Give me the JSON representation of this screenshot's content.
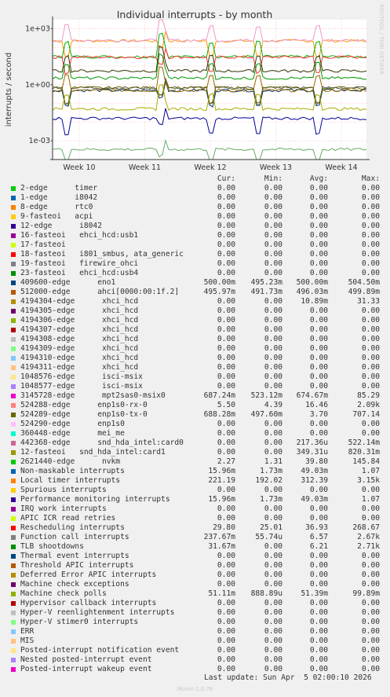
{
  "chart_data": {
    "type": "line",
    "title": "Individual interrupts - by month",
    "ylabel": "interrupts / second",
    "yscale": "log",
    "ylim": [
      0.0001,
      3000
    ],
    "yticks": [
      "1e+03",
      "1e+00",
      "1e-03"
    ],
    "xticks": [
      "Week 10",
      "Week 11",
      "Week 12",
      "Week 13",
      "Week 14"
    ],
    "watermark": "RRDTOOL / TOBI OETIKER",
    "grid": true,
    "series": [
      {
        "name": "Local timer interrupts",
        "color": "#ff9900",
        "level": 221.19
      },
      {
        "name": "TLB shootdowns",
        "color": "#00aa00",
        "level": 31.67
      },
      {
        "name": "Rescheduling interrupts",
        "color": "#ff3333",
        "level": 29.8
      },
      {
        "name": "Function call interrupts",
        "color": "#ee99cc",
        "level": 237.67
      },
      {
        "name": "409600-edge eno1",
        "color": "#003366",
        "level": 0.5
      },
      {
        "name": "512000-edge ahci[0000:00:1f.2]",
        "color": "#996600",
        "level": 0.49597
      },
      {
        "name": "3145728-edge mpt2sas0-msix0",
        "color": "#555555",
        "level": 0.68724
      },
      {
        "name": "524288-edge enp1s0-rx-0",
        "color": "#333300",
        "level": 5.5
      },
      {
        "name": "524289-edge enp1s0-tx-0",
        "color": "#666600",
        "level": 0.68828
      },
      {
        "name": "2621440-edge nvkm",
        "color": "#009900",
        "level": 2.27
      },
      {
        "name": "Non-maskable interrupts",
        "color": "#000099",
        "level": 0.01596
      },
      {
        "name": "Machine check polls",
        "color": "#aaaa00",
        "level": 0.05111
      },
      {
        "name": "12-fasteoi snd_hda_intel:card1",
        "color": "#66aa66",
        "level": 0.00035
      }
    ]
  },
  "legend": {
    "headers": [
      "Cur:",
      "Min:",
      "Avg:",
      "Max:"
    ],
    "rows": [
      {
        "label": "2-edge      timer",
        "color": "#00cc00",
        "cur": "0.00",
        "min": "0.00",
        "avg": "0.00",
        "max": "0.00"
      },
      {
        "label": "1-edge      i8042",
        "color": "#0066b3",
        "cur": "0.00",
        "min": "0.00",
        "avg": "0.00",
        "max": "0.00"
      },
      {
        "label": "8-edge      rtc0",
        "color": "#ff8000",
        "cur": "0.00",
        "min": "0.00",
        "avg": "0.00",
        "max": "0.00"
      },
      {
        "label": "9-fasteoi   acpi",
        "color": "#ffcc00",
        "cur": "0.00",
        "min": "0.00",
        "avg": "0.00",
        "max": "0.00"
      },
      {
        "label": "12-edge      i8042",
        "color": "#330099",
        "cur": "0.00",
        "min": "0.00",
        "avg": "0.00",
        "max": "0.00"
      },
      {
        "label": "16-fasteoi   ehci_hcd:usb1",
        "color": "#990099",
        "cur": "0.00",
        "min": "0.00",
        "avg": "0.00",
        "max": "0.00"
      },
      {
        "label": "17-fasteoi",
        "color": "#ccff00",
        "cur": "0.00",
        "min": "0.00",
        "avg": "0.00",
        "max": "0.00"
      },
      {
        "label": "18-fasteoi   i801_smbus, ata_generic",
        "color": "#ff0000",
        "cur": "0.00",
        "min": "0.00",
        "avg": "0.00",
        "max": "0.00"
      },
      {
        "label": "19-fasteoi   firewire_ohci",
        "color": "#808080",
        "cur": "0.00",
        "min": "0.00",
        "avg": "0.00",
        "max": "0.00"
      },
      {
        "label": "23-fasteoi   ehci_hcd:usb4",
        "color": "#008f00",
        "cur": "0.00",
        "min": "0.00",
        "avg": "0.00",
        "max": "0.00"
      },
      {
        "label": "409600-edge      eno1",
        "color": "#00487d",
        "cur": "500.00m",
        "min": "495.23m",
        "avg": "500.00m",
        "max": "504.50m"
      },
      {
        "label": "512000-edge      ahci[0000:00:1f.2]",
        "color": "#b35a00",
        "cur": "495.97m",
        "min": "491.73m",
        "avg": "496.03m",
        "max": "499.89m"
      },
      {
        "label": "4194304-edge      xhci_hcd",
        "color": "#b38f00",
        "cur": "0.00",
        "min": "0.00",
        "avg": "10.89m",
        "max": "31.33"
      },
      {
        "label": "4194305-edge      xhci_hcd",
        "color": "#6b006b",
        "cur": "0.00",
        "min": "0.00",
        "avg": "0.00",
        "max": "0.00"
      },
      {
        "label": "4194306-edge      xhci_hcd",
        "color": "#8fb300",
        "cur": "0.00",
        "min": "0.00",
        "avg": "0.00",
        "max": "0.00"
      },
      {
        "label": "4194307-edge      xhci_hcd",
        "color": "#b30000",
        "cur": "0.00",
        "min": "0.00",
        "avg": "0.00",
        "max": "0.00"
      },
      {
        "label": "4194308-edge      xhci_hcd",
        "color": "#bebebe",
        "cur": "0.00",
        "min": "0.00",
        "avg": "0.00",
        "max": "0.00"
      },
      {
        "label": "4194309-edge      xhci_hcd",
        "color": "#80ff80",
        "cur": "0.00",
        "min": "0.00",
        "avg": "0.00",
        "max": "0.00"
      },
      {
        "label": "4194310-edge      xhci_hcd",
        "color": "#80c9ff",
        "cur": "0.00",
        "min": "0.00",
        "avg": "0.00",
        "max": "0.00"
      },
      {
        "label": "4194311-edge      xhci_hcd",
        "color": "#ffc080",
        "cur": "0.00",
        "min": "0.00",
        "avg": "0.00",
        "max": "0.00"
      },
      {
        "label": "1048576-edge      isci-msix",
        "color": "#ffe680",
        "cur": "0.00",
        "min": "0.00",
        "avg": "0.00",
        "max": "0.00"
      },
      {
        "label": "1048577-edge      isci-msix",
        "color": "#aa80ff",
        "cur": "0.00",
        "min": "0.00",
        "avg": "0.00",
        "max": "0.00"
      },
      {
        "label": "3145728-edge      mpt2sas0-msix0",
        "color": "#ee00cc",
        "cur": "687.24m",
        "min": "523.12m",
        "avg": "674.67m",
        "max": "85.29"
      },
      {
        "label": "524288-edge      enp1s0-rx-0",
        "color": "#ff8080",
        "cur": "5.50",
        "min": "4.39",
        "avg": "16.46",
        "max": "2.09k"
      },
      {
        "label": "524289-edge      enp1s0-tx-0",
        "color": "#666600",
        "cur": "688.28m",
        "min": "497.60m",
        "avg": "3.70",
        "max": "707.14"
      },
      {
        "label": "524290-edge      enp1s0",
        "color": "#ffbfff",
        "cur": "0.00",
        "min": "0.00",
        "avg": "0.00",
        "max": "0.00"
      },
      {
        "label": "360448-edge      mei_me",
        "color": "#00ffcc",
        "cur": "0.00",
        "min": "0.00",
        "avg": "0.00",
        "max": "0.00"
      },
      {
        "label": "442368-edge      snd_hda_intel:card0",
        "color": "#cc6699",
        "cur": "0.00",
        "min": "0.00",
        "avg": "217.36u",
        "max": "522.14m"
      },
      {
        "label": "12-fasteoi   snd_hda_intel:card1",
        "color": "#999900",
        "cur": "0.00",
        "min": "0.00",
        "avg": "349.31u",
        "max": "820.31m"
      },
      {
        "label": "2621440-edge      nvkm",
        "color": "#00cc00",
        "cur": "2.27",
        "min": "1.31",
        "avg": "39.80",
        "max": "145.84"
      },
      {
        "label": "Non-maskable interrupts",
        "color": "#0066b3",
        "cur": "15.96m",
        "min": "1.73m",
        "avg": "49.03m",
        "max": "1.07"
      },
      {
        "label": "Local timer interrupts",
        "color": "#ff8000",
        "cur": "221.19",
        "min": "192.02",
        "avg": "312.39",
        "max": "3.15k"
      },
      {
        "label": "Spurious interrupts",
        "color": "#ffcc00",
        "cur": "0.00",
        "min": "0.00",
        "avg": "0.00",
        "max": "0.00"
      },
      {
        "label": "Performance monitoring interrupts",
        "color": "#330099",
        "cur": "15.96m",
        "min": "1.73m",
        "avg": "49.03m",
        "max": "1.07"
      },
      {
        "label": "IRQ work interrupts",
        "color": "#990099",
        "cur": "0.00",
        "min": "0.00",
        "avg": "0.00",
        "max": "0.00"
      },
      {
        "label": "APIC ICR read retries",
        "color": "#ccff00",
        "cur": "0.00",
        "min": "0.00",
        "avg": "0.00",
        "max": "0.00"
      },
      {
        "label": "Rescheduling interrupts",
        "color": "#ff0000",
        "cur": "29.80",
        "min": "25.01",
        "avg": "36.93",
        "max": "268.67"
      },
      {
        "label": "Function call interrupts",
        "color": "#808080",
        "cur": "237.67m",
        "min": "55.74u",
        "avg": "6.57",
        "max": "2.67k"
      },
      {
        "label": "TLB shootdowns",
        "color": "#008f00",
        "cur": "31.67m",
        "min": "0.00",
        "avg": "6.21",
        "max": "2.71k"
      },
      {
        "label": "Thermal event interrupts",
        "color": "#00487d",
        "cur": "0.00",
        "min": "0.00",
        "avg": "0.00",
        "max": "0.00"
      },
      {
        "label": "Threshold APIC interrupts",
        "color": "#b35a00",
        "cur": "0.00",
        "min": "0.00",
        "avg": "0.00",
        "max": "0.00"
      },
      {
        "label": "Deferred Error APIC interrupts",
        "color": "#b38f00",
        "cur": "0.00",
        "min": "0.00",
        "avg": "0.00",
        "max": "0.00"
      },
      {
        "label": "Machine check exceptions",
        "color": "#6b006b",
        "cur": "0.00",
        "min": "0.00",
        "avg": "0.00",
        "max": "0.00"
      },
      {
        "label": "Machine check polls",
        "color": "#8fb300",
        "cur": "51.11m",
        "min": "888.89u",
        "avg": "51.39m",
        "max": "99.89m"
      },
      {
        "label": "Hypervisor callback interrupts",
        "color": "#b30000",
        "cur": "0.00",
        "min": "0.00",
        "avg": "0.00",
        "max": "0.00"
      },
      {
        "label": "Hyper-V reenlightenment interrupts",
        "color": "#bebebe",
        "cur": "0.00",
        "min": "0.00",
        "avg": "0.00",
        "max": "0.00"
      },
      {
        "label": "Hyper-V stimer0 interrupts",
        "color": "#80ff80",
        "cur": "0.00",
        "min": "0.00",
        "avg": "0.00",
        "max": "0.00"
      },
      {
        "label": "ERR",
        "color": "#80c9ff",
        "cur": "0.00",
        "min": "0.00",
        "avg": "0.00",
        "max": "0.00"
      },
      {
        "label": "MIS",
        "color": "#ffc080",
        "cur": "0.00",
        "min": "0.00",
        "avg": "0.00",
        "max": "0.00"
      },
      {
        "label": "Posted-interrupt notification event",
        "color": "#ffe680",
        "cur": "0.00",
        "min": "0.00",
        "avg": "0.00",
        "max": "0.00"
      },
      {
        "label": "Nested posted-interrupt event",
        "color": "#aa80ff",
        "cur": "0.00",
        "min": "0.00",
        "avg": "0.00",
        "max": "0.00"
      },
      {
        "label": "Posted-interrupt wakeup event",
        "color": "#ee00cc",
        "cur": "0.00",
        "min": "0.00",
        "avg": "0.00",
        "max": "0.00"
      }
    ]
  },
  "footer": {
    "last_update": "Last update: Sun Apr  5 02:00:10 2026",
    "munin": "Munin 2.0.76"
  }
}
